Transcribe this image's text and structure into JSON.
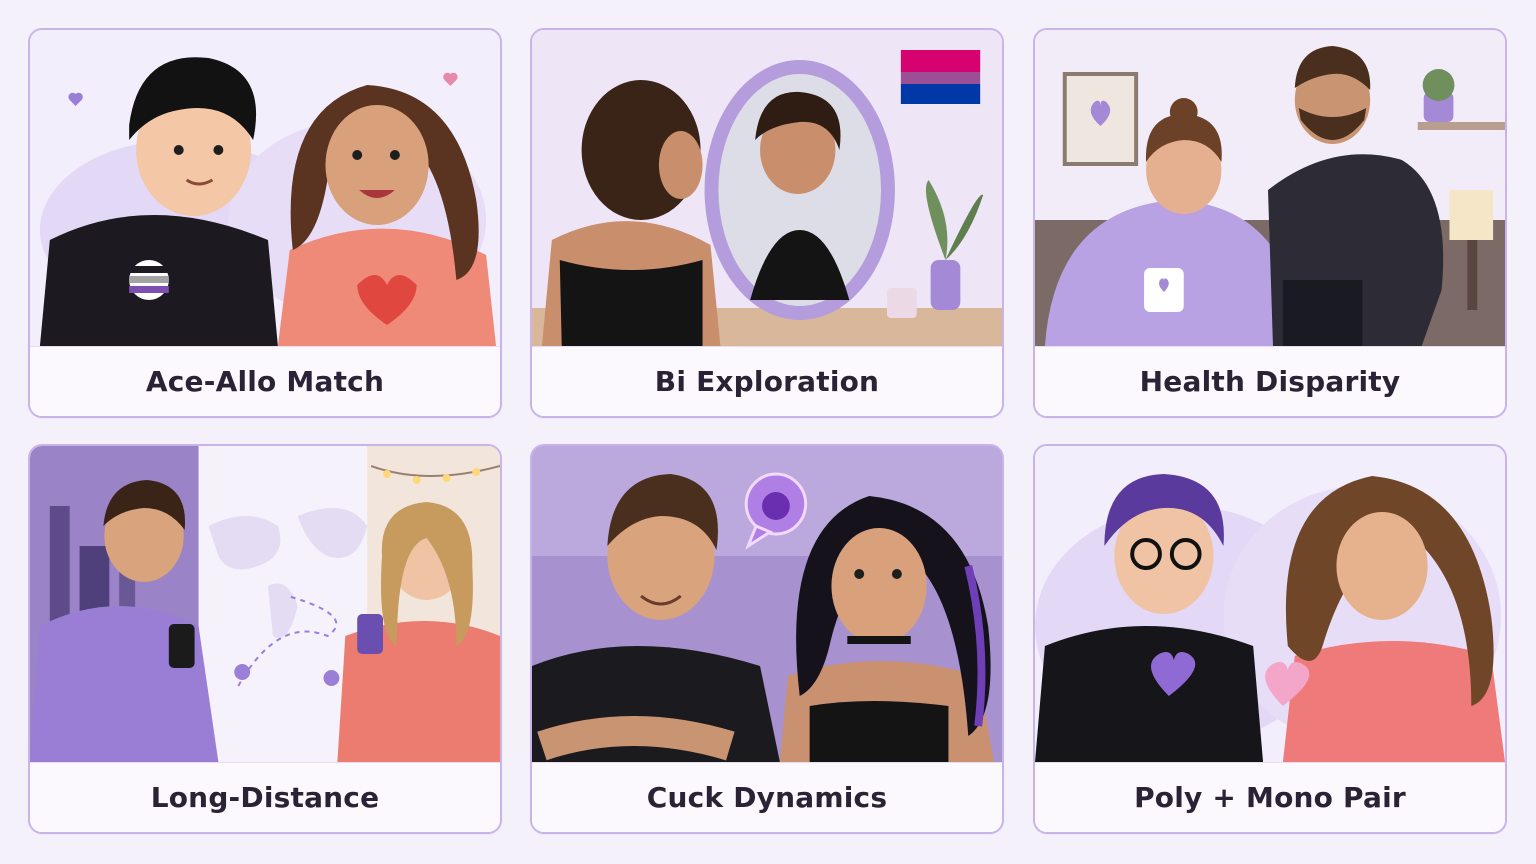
{
  "cards": [
    {
      "label": "Ace-Allo Match",
      "illustration": "couple-ace-pin-heart-shirt-icon"
    },
    {
      "label": "Bi Exploration",
      "illustration": "woman-mirror-bi-flag-icon"
    },
    {
      "label": "Health Disparity",
      "illustration": "woman-blanket-mug-man-standing-icon"
    },
    {
      "label": "Long-Distance",
      "illustration": "couple-phones-world-map-icon"
    },
    {
      "label": "Cuck Dynamics",
      "illustration": "couple-devil-speech-bubble-icon"
    },
    {
      "label": "Poly + Mono Pair",
      "illustration": "couple-holding-hearts-icon"
    }
  ],
  "colors": {
    "page_background": "#f5f1fb",
    "card_border": "#c9b4ea",
    "accent_purple": "#9b7fd6",
    "label_text": "#2a2235"
  }
}
